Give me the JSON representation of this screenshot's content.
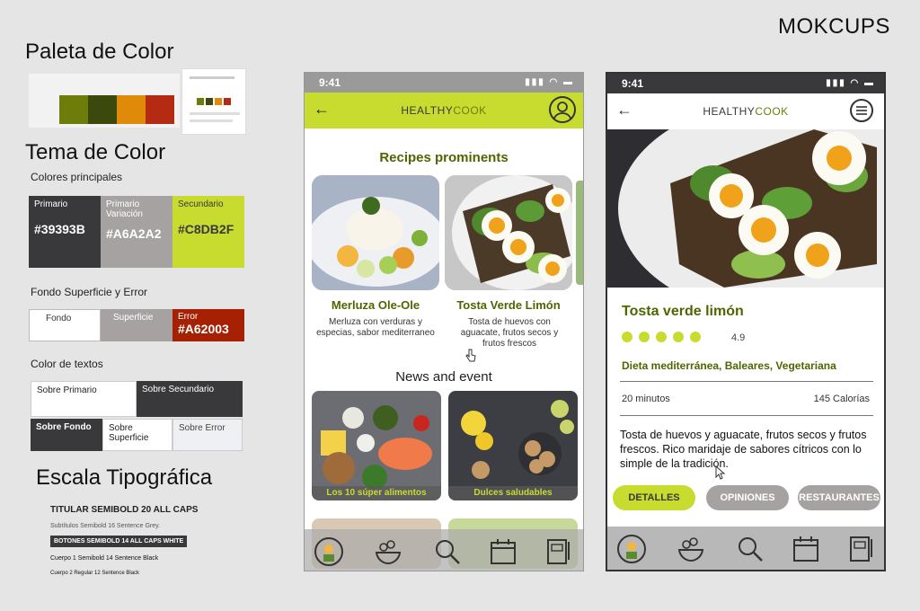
{
  "header": {
    "title": "MOKCUPS"
  },
  "palette": {
    "title": "Paleta de Color",
    "swatches": [
      "#6e7d0a",
      "#3b4a0c",
      "#e08a0a",
      "#b52a12"
    ]
  },
  "theme": {
    "title": "Tema de Color",
    "principales_label": "Colores principales",
    "primario": {
      "label": "Primario",
      "value": "#39393B"
    },
    "variacion": {
      "label": "Primario Variación",
      "value": "#A6A2A2"
    },
    "secundario": {
      "label": "Secundario",
      "value": "#C8DB2F"
    },
    "fondo_label": "Fondo Superficie y Error",
    "fondo": {
      "label": "Fondo"
    },
    "superficie": {
      "label": "Superficie"
    },
    "error": {
      "label": "Error",
      "value": "#A62003"
    },
    "textos_label": "Color de textos",
    "sobre_primario": "Sobre Primario",
    "sobre_secundario": "Sobre Secundario",
    "sobre_fondo": "Sobre Fondo",
    "sobre_superficie": "Sobre Superficie",
    "sobre_error": "Sobre Error"
  },
  "typography": {
    "title": "Escala Tipográfica",
    "titular": "TITULAR SEMIBOLD 20 ALL CAPS",
    "subtitulos": "Subtítulos Semibold 16 Sentence Grey.",
    "botones": "BOTONES SEMIBOLD 14 ALL CAPS WHITE",
    "cuerpo1": "Cuerpo 1 Semibold 14 Sentence Black",
    "cuerpo2": "Cuerpo 2 Regular 12 Sentence Black"
  },
  "phone1": {
    "time": "9:41",
    "brand_a": "HEALTHY",
    "brand_b": "COOK",
    "section_title": "Recipes prominents",
    "cards": [
      {
        "title": "Merluza Ole-Ole",
        "desc": "Merluza con verduras y especias, sabor mediterraneo"
      },
      {
        "title": "Tosta Verde Limón",
        "desc": "Tosta de huevos con aguacate, frutos secos y frutos frescos"
      }
    ],
    "news_title": "News and event",
    "news": [
      {
        "label": "Los 10 súper alimentos"
      },
      {
        "label": "Dulces saludables"
      }
    ]
  },
  "phone2": {
    "time": "9:41",
    "brand_a": "HEALTHY",
    "brand_b": "COOK",
    "recipe_title": "Tosta verde limón",
    "rating": "4.9",
    "rating_fraction": 1.0,
    "tags": "Dieta mediterránea, Baleares,  Vegetariana",
    "time_label": "20 minutos",
    "calories": "145 Calorías",
    "description": "Tosta de huevos y aguacate,  frutos secos y frutos frescos. Rico maridaje de sabores cítricos con lo simple de la tradición.",
    "buttons": [
      "DETALLES",
      "OPINIONES",
      "RESTAURANTES"
    ]
  },
  "icons": {
    "back": "back-arrow-icon",
    "profile": "profile-icon",
    "menu": "menu-icon",
    "nav": [
      "chef-icon",
      "salad-icon",
      "search-icon",
      "calendar-icon",
      "notebook-icon"
    ]
  },
  "colors": {
    "primary": "#39393B",
    "variation": "#A6A2A2",
    "secondary": "#C8DB2F",
    "error": "#A62003",
    "title_green": "#4e6500"
  }
}
